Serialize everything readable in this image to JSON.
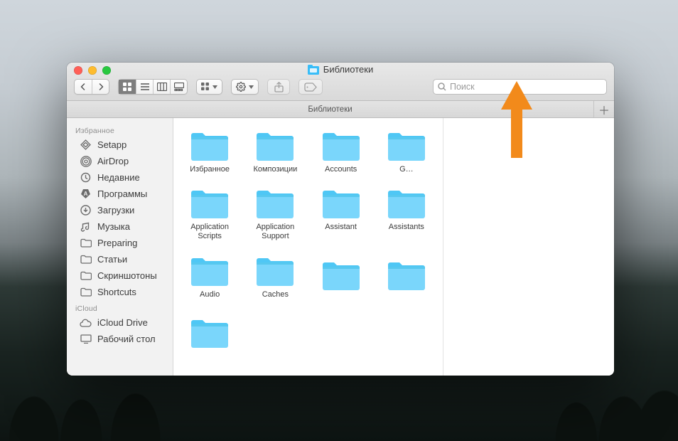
{
  "window": {
    "title": "Библиотеки",
    "search_placeholder": "Поиск",
    "tabs": [
      {
        "label": "Библиотеки"
      }
    ]
  },
  "toolbar": {
    "view_modes": [
      "icon-view",
      "list-view",
      "column-view",
      "gallery-view"
    ],
    "active_view": "icon-view"
  },
  "sidebar": {
    "sections": [
      {
        "heading": "Избранное",
        "items": [
          {
            "icon": "setapp",
            "label": "Setapp"
          },
          {
            "icon": "airdrop",
            "label": "AirDrop"
          },
          {
            "icon": "recents",
            "label": "Недавние"
          },
          {
            "icon": "applications",
            "label": "Программы"
          },
          {
            "icon": "downloads",
            "label": "Загрузки"
          },
          {
            "icon": "music",
            "label": "Музыка"
          },
          {
            "icon": "folder",
            "label": "Preparing"
          },
          {
            "icon": "folder",
            "label": "Статьи"
          },
          {
            "icon": "folder",
            "label": "Скриншотоны"
          },
          {
            "icon": "folder",
            "label": "Shortcuts"
          }
        ]
      },
      {
        "heading": "iCloud",
        "items": [
          {
            "icon": "icloud",
            "label": "iCloud Drive"
          },
          {
            "icon": "desktop",
            "label": "Рабочий стол"
          }
        ]
      }
    ]
  },
  "folders": [
    {
      "name": "Избранное"
    },
    {
      "name": "Композиции"
    },
    {
      "name": "Accounts"
    },
    {
      "name": "G…"
    },
    {
      "name": "Application Scripts"
    },
    {
      "name": "Application Support"
    },
    {
      "name": "Assistant"
    },
    {
      "name": "Assistants"
    },
    {
      "name": "Audio"
    },
    {
      "name": "Caches"
    }
  ],
  "colors": {
    "folder_light": "#7ad6fb",
    "folder_dark": "#4fc7f5",
    "annotation": "#f28a1b"
  }
}
